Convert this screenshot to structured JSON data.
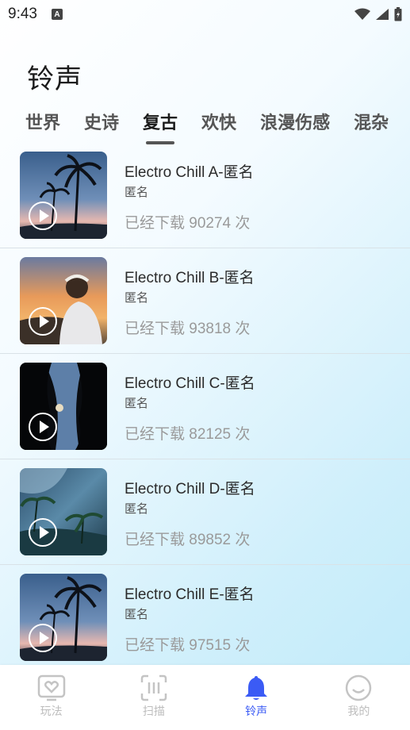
{
  "status_bar": {
    "time": "9:43",
    "badge": "A"
  },
  "page_title": "铃声",
  "tabs": [
    "世界",
    "史诗",
    "复古",
    "欢快",
    "浪漫伤感",
    "混杂"
  ],
  "active_tab": "复古",
  "items": [
    {
      "title": "Electro Chill A-匿名",
      "artist": "匿名",
      "downloads": "已经下载 90274 次",
      "thumb": "palm-sunset"
    },
    {
      "title": "Electro Chill B-匿名",
      "artist": "匿名",
      "downloads": "已经下载 93818 次",
      "thumb": "girl-sunset"
    },
    {
      "title": "Electro Chill C-匿名",
      "artist": "匿名",
      "downloads": "已经下载 82125 次",
      "thumb": "night-trees-moon"
    },
    {
      "title": "Electro Chill D-匿名",
      "artist": "匿名",
      "downloads": "已经下载 89852 次",
      "thumb": "palm-ocean"
    },
    {
      "title": "Electro Chill E-匿名",
      "artist": "匿名",
      "downloads": "已经下载 97515 次",
      "thumb": "palm-sunset"
    }
  ],
  "nav": [
    {
      "label": "玩法",
      "icon": "heart-card-icon"
    },
    {
      "label": "扫描",
      "icon": "scan-icon"
    },
    {
      "label": "铃声",
      "icon": "bell-icon"
    },
    {
      "label": "我的",
      "icon": "smile-icon"
    }
  ],
  "active_nav": "铃声",
  "colors": {
    "accent": "#3b5bf5",
    "inactive": "#bdbdbd",
    "muted_text": "#9a9a9a"
  }
}
